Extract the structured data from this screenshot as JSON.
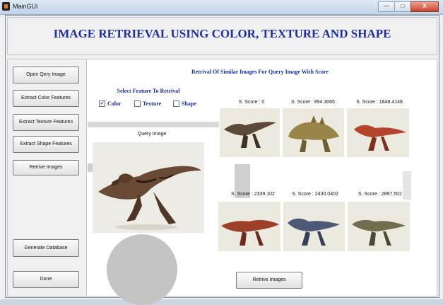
{
  "window": {
    "title": "MainGUI",
    "controls": [
      "—",
      "□",
      "X"
    ]
  },
  "header": {
    "title": "IMAGE RETRIEVAL USING COLOR, TEXTURE AND SHAPE"
  },
  "sidebar": {
    "buttons": [
      "Open Qery Image",
      "Extract Color Features",
      "Extract Texture Features",
      "Extract Shape Features",
      "Retrive Images",
      "Generate Database",
      "Done"
    ]
  },
  "main": {
    "retrieval_title": "Retrival Of Similar Images For Query Image With Score",
    "select_label": "Select Feature To Retrival",
    "features": [
      {
        "label": "Color",
        "checked": true
      },
      {
        "label": "Texture",
        "checked": false
      },
      {
        "label": "Shape",
        "checked": false
      }
    ],
    "query_label": "Query Image",
    "scores": [
      "S. Score : 0",
      "S. Score : 894.3065",
      "S. Score : 1848.4148",
      "S. Score : 2339.102",
      "S. Score : 2430.0402",
      "S. Score : 2897.502"
    ],
    "retrieve_button": "Retrive Images"
  },
  "colors": {
    "title_blue": "#1d2da0",
    "panel": "#f0f0f0",
    "close": "#c9432a"
  }
}
